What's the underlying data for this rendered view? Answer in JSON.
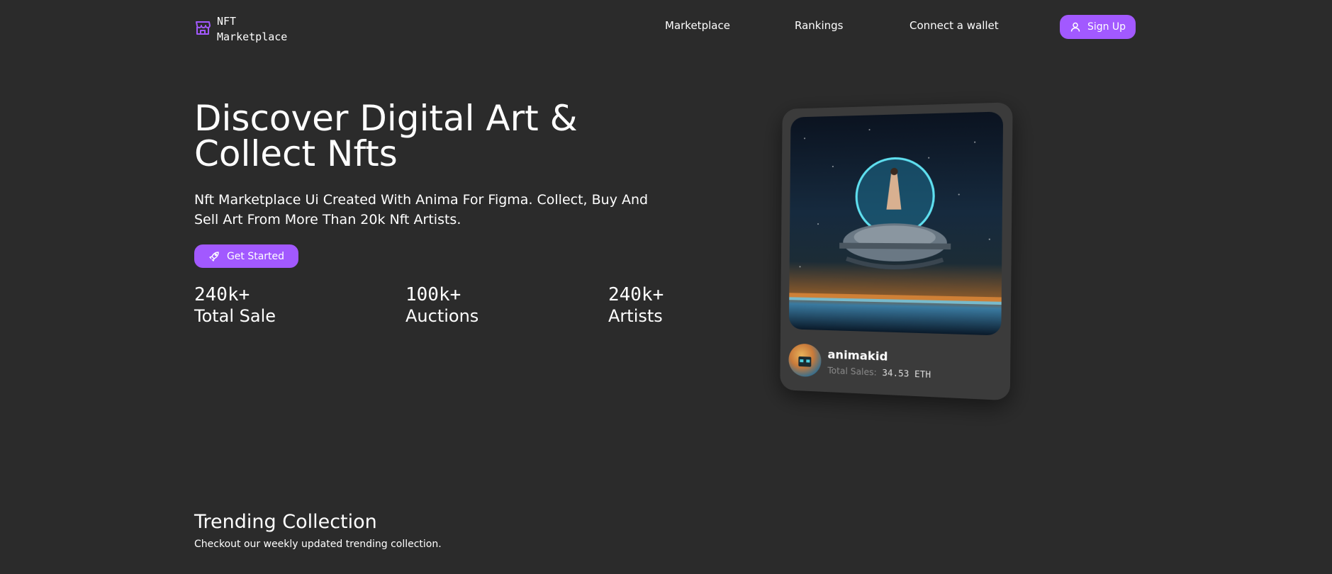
{
  "header": {
    "logo_line1": "NFT",
    "logo_line2": "Marketplace",
    "nav": [
      {
        "label": "Marketplace"
      },
      {
        "label": "Rankings"
      },
      {
        "label": "Connect a wallet"
      }
    ],
    "signup_label": "Sign Up"
  },
  "hero": {
    "title": "Discover Digital Art & Collect Nfts",
    "subtitle": "Nft Marketplace Ui Created With Anima For Figma. Collect, Buy And Sell Art From More Than 20k Nft Artists.",
    "cta_label": "Get Started",
    "stats": [
      {
        "value": "240k+",
        "label": "Total Sale"
      },
      {
        "value": "100k+",
        "label": "Auctions"
      },
      {
        "value": "240k+",
        "label": "Artists"
      }
    ]
  },
  "featured_card": {
    "creator": "animakid",
    "sales_label": "Total Sales:",
    "sales_value": "34.53",
    "sales_unit": "ETH"
  },
  "trending": {
    "title": "Trending Collection",
    "subtitle": "Checkout our weekly updated trending collection."
  },
  "colors": {
    "background": "#2b2b2b",
    "accent": "#a259ff",
    "card": "#3b3b3b"
  },
  "icons": [
    "storefront-icon",
    "user-icon",
    "rocket-icon"
  ]
}
